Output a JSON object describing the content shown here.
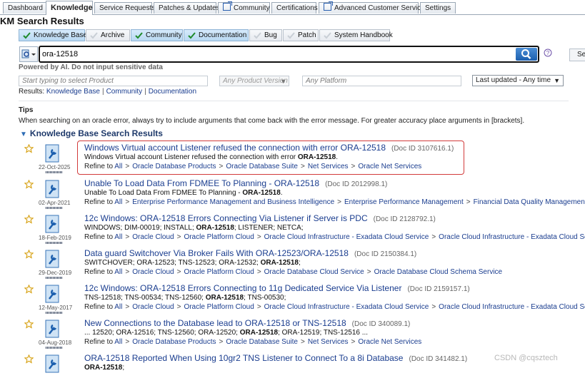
{
  "tabs": [
    {
      "label": "Dashboard",
      "active": false,
      "external": false
    },
    {
      "label": "Knowledge",
      "active": true,
      "external": false
    },
    {
      "label": "Service Requests",
      "active": false,
      "external": false
    },
    {
      "label": "Patches & Updates",
      "active": false,
      "external": false
    },
    {
      "label": "Community",
      "active": false,
      "external": true
    },
    {
      "label": "Certifications",
      "active": false,
      "external": false
    },
    {
      "label": "Advanced Customer Services",
      "active": false,
      "external": true
    },
    {
      "label": "Settings",
      "active": false,
      "external": false
    }
  ],
  "page_title": "KM Search Results",
  "filters": [
    {
      "label": "Knowledge Base",
      "on": true
    },
    {
      "label": "Archive",
      "on": false
    },
    {
      "label": "Community",
      "on": true
    },
    {
      "label": "Documentation",
      "on": true
    },
    {
      "label": "Bug",
      "on": false
    },
    {
      "label": "Patch",
      "on": false
    },
    {
      "label": "System Handbook",
      "on": false
    }
  ],
  "search": {
    "value": "ora-12518",
    "button_partial": "Sea"
  },
  "powered_note": "Powered by AI. Do not input sensitive data",
  "product_placeholder": "Start typing to select Product",
  "version_placeholder": "Any Product Version",
  "platform_placeholder": "Any Platform",
  "updated_select": "Last updated - Any time",
  "results_prefix": "Results:",
  "results_links": [
    "Knowledge Base",
    "Community",
    "Documentation"
  ],
  "tips_heading": "Tips",
  "tips_text": "When searching on an oracle error, always try to include arguments that come back with the error message. For greater accuracy place arguments in [brackets].",
  "section_heading": "Knowledge Base Search Results",
  "results": [
    {
      "title": "Windows Virtual account Listener refused the connection with error ORA-12518",
      "doc_id": "(Doc ID 3107616.1)",
      "snippet_pre": "Windows Virtual account Listener refused the connection with error ",
      "snippet_bold": "ORA-12518",
      "snippet_post": ".",
      "date": "22-Oct-2025",
      "refine_label": "Refine to",
      "refine": [
        "All",
        "Oracle Database Products",
        "Oracle Database Suite",
        "Net Services",
        "Oracle Net Services"
      ]
    },
    {
      "title": "Unable To Load Data From FDMEE To Planning - ORA-12518",
      "doc_id": "(Doc ID 2012998.1)",
      "snippet_pre": "Unable To Load Data From FDMEE To Planning - ",
      "snippet_bold": "ORA-12518",
      "snippet_post": ".",
      "date": "02-Apr-2021",
      "refine_label": "Refine to",
      "refine": [
        "All",
        "Enterprise Performance Management and Business Intelligence",
        "Enterprise Performance Management",
        "Financial Data Quality Management"
      ]
    },
    {
      "title": "12c Windows: ORA-12518 Errors Connecting Via Listener if Server is PDC",
      "doc_id": "(Doc ID 2128792.1)",
      "snippet_pre": "WINDOWS; DIM-00019; INSTALL; ",
      "snippet_bold": "ORA-12518",
      "snippet_post": "; LISTENER; NETCA;",
      "date": "18-Feb-2019",
      "refine_label": "Refine to",
      "refine": [
        "All",
        "Oracle Cloud",
        "Oracle Platform Cloud",
        "Oracle Cloud Infrastructure - Exadata Cloud Service",
        "Oracle Cloud Infrastructure - Exadata Cloud Service"
      ]
    },
    {
      "title": "Data guard Switchover Via Broker Fails With ORA-12523/ORA-12518",
      "doc_id": "(Doc ID 2150384.1)",
      "snippet_pre": "SWITCHOVER; ORA-12523; TNS-12523; ORA-12532; ",
      "snippet_bold": "ORA-12518",
      "snippet_post": ";",
      "date": "29-Dec-2019",
      "refine_label": "Refine to",
      "refine": [
        "All",
        "Oracle Cloud",
        "Oracle Platform Cloud",
        "Oracle Database Cloud Service",
        "Oracle Database Cloud Schema Service"
      ]
    },
    {
      "title": "12c Windows: ORA-12518 Errors Connecting to 11g Dedicated Service Via Listener",
      "doc_id": "(Doc ID 2159157.1)",
      "snippet_pre": "TNS-12518; TNS-00534; TNS-12560; ",
      "snippet_bold": "ORA-12518",
      "snippet_post": "; TNS-00530;",
      "date": "12-May-2017",
      "refine_label": "Refine to",
      "refine": [
        "All",
        "Oracle Cloud",
        "Oracle Platform Cloud",
        "Oracle Cloud Infrastructure - Exadata Cloud Service",
        "Oracle Cloud Infrastructure - Exadata Cloud Service"
      ]
    },
    {
      "title": "New Connections to the Database lead to ORA-12518 or TNS-12518",
      "doc_id": "(Doc ID 340089.1)",
      "snippet_pre": "... 12520; ORA-12516; TNS-12560; ORA-12520; ",
      "snippet_bold": "ORA-12518",
      "snippet_post": "; ORA-12519; TNS-12516 ...",
      "date": "04-Aug-2018",
      "refine_label": "Refine to",
      "refine": [
        "All",
        "Oracle Database Products",
        "Oracle Database Suite",
        "Net Services",
        "Oracle Net Services"
      ]
    },
    {
      "title": "ORA-12518 Reported When Using 10gr2 TNS Listener to Connect To a 8i Database",
      "doc_id": "(Doc ID 341482.1)",
      "snippet_pre": "",
      "snippet_bold": "ORA-12518",
      "snippet_post": ";",
      "date": "",
      "refine_label": "",
      "refine": []
    }
  ],
  "watermark": "CSDN @cqsztech",
  "colors": {
    "link": "#1d4a9b",
    "highlight_border": "#d23b3b",
    "search_button": "#1c5fae"
  }
}
